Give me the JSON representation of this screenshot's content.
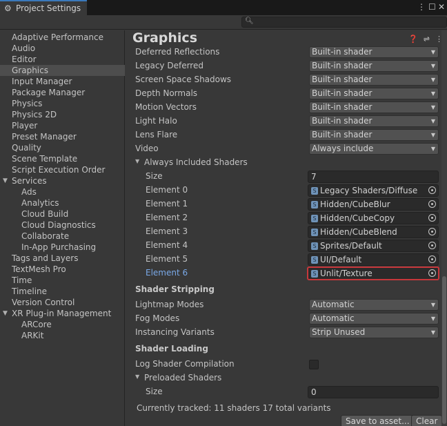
{
  "window": {
    "tab_title": "Project Settings",
    "tab_icon": "gear-icon",
    "menu_icon": "kebab-menu-icon",
    "maximize_icon": "maximize-icon",
    "close_icon": "close-icon"
  },
  "search": {
    "icon": "search-icon",
    "placeholder": ""
  },
  "sidebar": {
    "items": [
      {
        "label": "Adaptive Performance"
      },
      {
        "label": "Audio"
      },
      {
        "label": "Editor"
      },
      {
        "label": "Graphics",
        "selected": true
      },
      {
        "label": "Input Manager"
      },
      {
        "label": "Package Manager"
      },
      {
        "label": "Physics"
      },
      {
        "label": "Physics 2D"
      },
      {
        "label": "Player"
      },
      {
        "label": "Preset Manager"
      },
      {
        "label": "Quality"
      },
      {
        "label": "Scene Template"
      },
      {
        "label": "Script Execution Order"
      },
      {
        "label": "Services",
        "expanded": true
      },
      {
        "label": "Ads"
      },
      {
        "label": "Analytics"
      },
      {
        "label": "Cloud Build"
      },
      {
        "label": "Cloud Diagnostics"
      },
      {
        "label": "Collaborate"
      },
      {
        "label": "In-App Purchasing"
      },
      {
        "label": "Tags and Layers"
      },
      {
        "label": "TextMesh Pro"
      },
      {
        "label": "Time"
      },
      {
        "label": "Timeline"
      },
      {
        "label": "Version Control"
      },
      {
        "label": "XR Plug-in Management",
        "expanded": true
      },
      {
        "label": "ARCore"
      },
      {
        "label": "ARKit"
      }
    ]
  },
  "main": {
    "title": "Graphics",
    "header_icons": [
      "help-icon",
      "preset-icon",
      "more-icon"
    ],
    "builtin_shaders": [
      {
        "label": "Deferred Reflections",
        "value": "Built-in shader"
      },
      {
        "label": "Legacy Deferred",
        "value": "Built-in shader"
      },
      {
        "label": "Screen Space Shadows",
        "value": "Built-in shader"
      },
      {
        "label": "Depth Normals",
        "value": "Built-in shader"
      },
      {
        "label": "Motion Vectors",
        "value": "Built-in shader"
      },
      {
        "label": "Light Halo",
        "value": "Built-in shader"
      },
      {
        "label": "Lens Flare",
        "value": "Built-in shader"
      },
      {
        "label": "Video",
        "value": "Always include"
      }
    ],
    "always_included": {
      "label": "Always Included Shaders",
      "size_label": "Size",
      "size_value": "7",
      "elements": [
        {
          "label": "Element 0",
          "value": "Legacy Shaders/Diffuse"
        },
        {
          "label": "Element 1",
          "value": "Hidden/CubeBlur"
        },
        {
          "label": "Element 2",
          "value": "Hidden/CubeCopy"
        },
        {
          "label": "Element 3",
          "value": "Hidden/CubeBlend"
        },
        {
          "label": "Element 4",
          "value": "Sprites/Default"
        },
        {
          "label": "Element 5",
          "value": "UI/Default"
        },
        {
          "label": "Element 6",
          "value": "Unlit/Texture",
          "selected": true
        }
      ]
    },
    "shader_stripping": {
      "title": "Shader Stripping",
      "rows": [
        {
          "label": "Lightmap Modes",
          "value": "Automatic"
        },
        {
          "label": "Fog Modes",
          "value": "Automatic"
        },
        {
          "label": "Instancing Variants",
          "value": "Strip Unused"
        }
      ]
    },
    "shader_loading": {
      "title": "Shader Loading",
      "log_label": "Log Shader Compilation",
      "log_checked": false,
      "preloaded_label": "Preloaded Shaders",
      "size_label": "Size",
      "size_value": "0"
    },
    "status": "Currently tracked: 11 shaders 17 total variants",
    "save_button": "Save to asset...",
    "clear_button": "Clear"
  },
  "colors": {
    "accent": "#3a79bb",
    "selection_outline": "#c7373b",
    "highlight_label": "#7aa9e8"
  }
}
